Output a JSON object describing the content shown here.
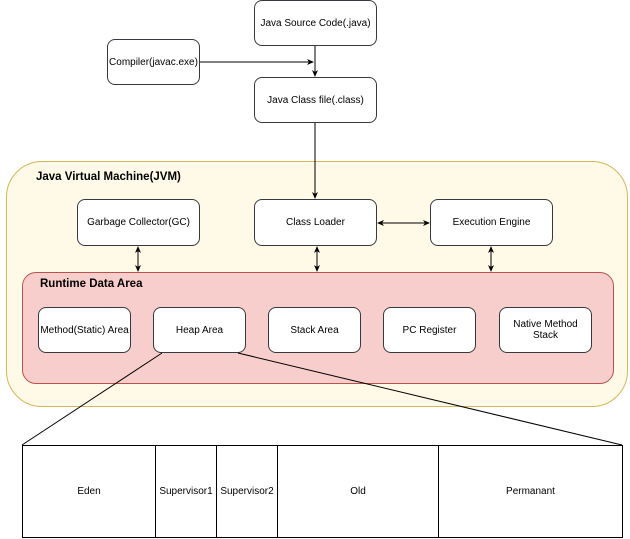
{
  "diagram": {
    "nodes": {
      "source_code": "Java Source Code(.java)",
      "compiler": "Compiler(javac.exe)",
      "class_file": "Java Class file(.class)",
      "garbage_collector": "Garbage Collector(GC)",
      "class_loader": "Class Loader",
      "execution_engine": "Execution Engine"
    },
    "jvm": {
      "title": "Java Virtual Machine(JVM)"
    },
    "runtime_data_area": {
      "title": "Runtime Data Area",
      "areas": [
        "Method(Static) Area",
        "Heap Area",
        "Stack Area",
        "PC Register",
        "Native Method Stack"
      ]
    },
    "heap_breakdown": [
      "Eden",
      "Supervisor1",
      "Supervisor2",
      "Old",
      "Permanant"
    ],
    "colors": {
      "jvm_fill": "#fff9e8",
      "jvm_stroke": "#d6b656",
      "runtime_fill": "#f8cecc",
      "runtime_stroke": "#b85450"
    }
  }
}
